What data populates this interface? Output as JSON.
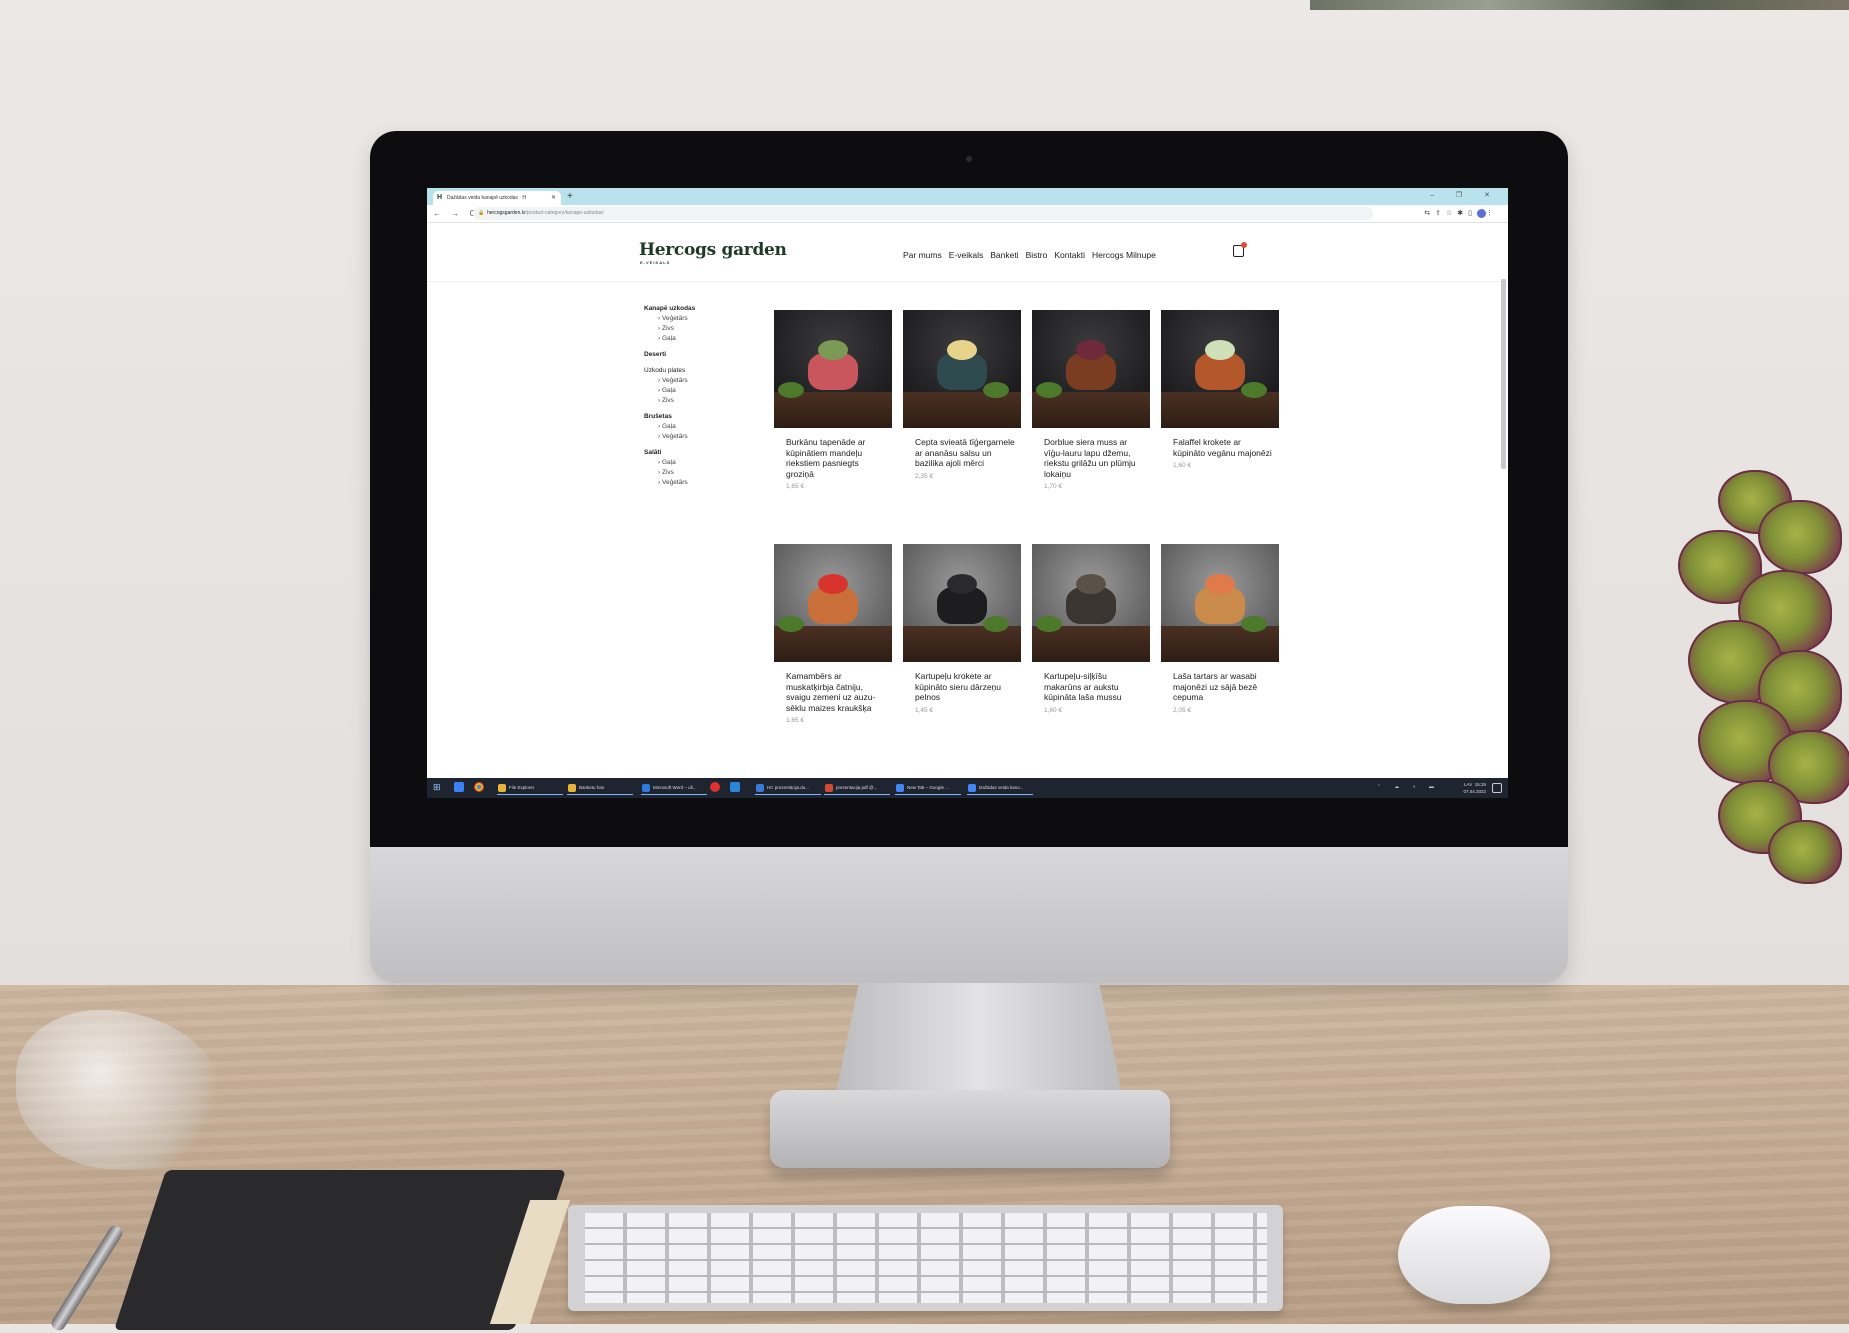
{
  "browser": {
    "tab_title": "Dažādas veida kanapē uzkodas · H",
    "favicon": "H",
    "new_tab": "+",
    "window_controls": "– ❐ ✕",
    "nav_buttons": "← → C",
    "url_domain": "hercogsgarden.lv",
    "url_path": "/product-category/kanape-uzkodas/"
  },
  "site": {
    "logo": "Hercogs garden",
    "logo_sub": "E-VEIKALS",
    "nav": [
      "Par mums",
      "E-veikals",
      "Banketi",
      "Bistro",
      "Kontakti",
      "Hercogs Milnupe"
    ]
  },
  "sidebar": [
    {
      "label": "Kanapē uzkodas",
      "bold": true,
      "subs": [
        "Veģetārs",
        "Zivs",
        "Gaļa"
      ]
    },
    {
      "label": "Deserti",
      "bold": true,
      "subs": []
    },
    {
      "label": "Uzkodu plates",
      "bold": false,
      "subs": [
        "Veģetārs",
        "Gaļa",
        "Zivs"
      ]
    },
    {
      "label": "Brušetas",
      "bold": true,
      "subs": [
        "Gaļa",
        "Veģetārs"
      ]
    },
    {
      "label": "Salāti",
      "bold": true,
      "subs": [
        "Gaļa",
        "Zivs",
        "Veģetārs"
      ]
    }
  ],
  "products": [
    {
      "name": "Burkānu tapenāde ar kūpinātiem mandeļu riekstiem pasniegts groziņā",
      "price": "1,65 €",
      "food": "#c9565d",
      "top": "#7a9a56",
      "bg": "dark"
    },
    {
      "name": "Cepta svieatā tīģergarnele ar ananāsu salsu un bazilika ajoli mērci",
      "price": "2,35 €",
      "food": "#2f4a4e",
      "top": "#e8d38a",
      "bg": "dark"
    },
    {
      "name": "Dorblue siera muss ar vīģu-lauru lapu džemu, riekstu grilāžu un plūmju lokaiņu",
      "price": "1,70 €",
      "food": "#7a3d22",
      "top": "#6e2a3a",
      "bg": "dark"
    },
    {
      "name": "Falaffel krokete ar kūpināto vegānu majonēzi",
      "price": "1,60 €",
      "food": "#b4582c",
      "top": "#cfe0b8",
      "bg": "dark"
    },
    {
      "name": "Kamambērs ar muskatķirbja čatniju, svaigu zemeni uz auzu-sēklu maizes kraukšķa",
      "price": "1,65 €",
      "food": "#c9703a",
      "top": "#d8342e",
      "bg": "light"
    },
    {
      "name": "Kartupeļu krokete ar kūpināto sieru dārzeņu pelnos",
      "price": "1,45 €",
      "food": "#1d1d1f",
      "top": "#2a2a2c",
      "bg": "light"
    },
    {
      "name": "Kartupeļu-siļķīšu makarūns ar aukstu kūpināta laša mussu",
      "price": "1,60 €",
      "food": "#3a3530",
      "top": "#5a5248",
      "bg": "light"
    },
    {
      "name": "Laša tartars ar wasabi majonēzi uz sājā bezē cepuma",
      "price": "2,05 €",
      "food": "#c98a4a",
      "top": "#e07a4a",
      "bg": "light"
    }
  ],
  "taskbar": {
    "items": [
      "File Explorer",
      "Banketu foto",
      "Microsoft Word – uš...",
      "HC prezentācija.du...",
      "prezentacija.pdf @...",
      "New Tab – Google ...",
      "Dažādas veida kano..."
    ],
    "item_colors": [
      "#e9b33a",
      "#e9b33a",
      "#2e7be0",
      "#3a7ad6",
      "#d24a2f",
      "#4285f4",
      "#4285f4"
    ],
    "lang": "LAV",
    "time": "15:26",
    "date": "07.04.2022"
  }
}
